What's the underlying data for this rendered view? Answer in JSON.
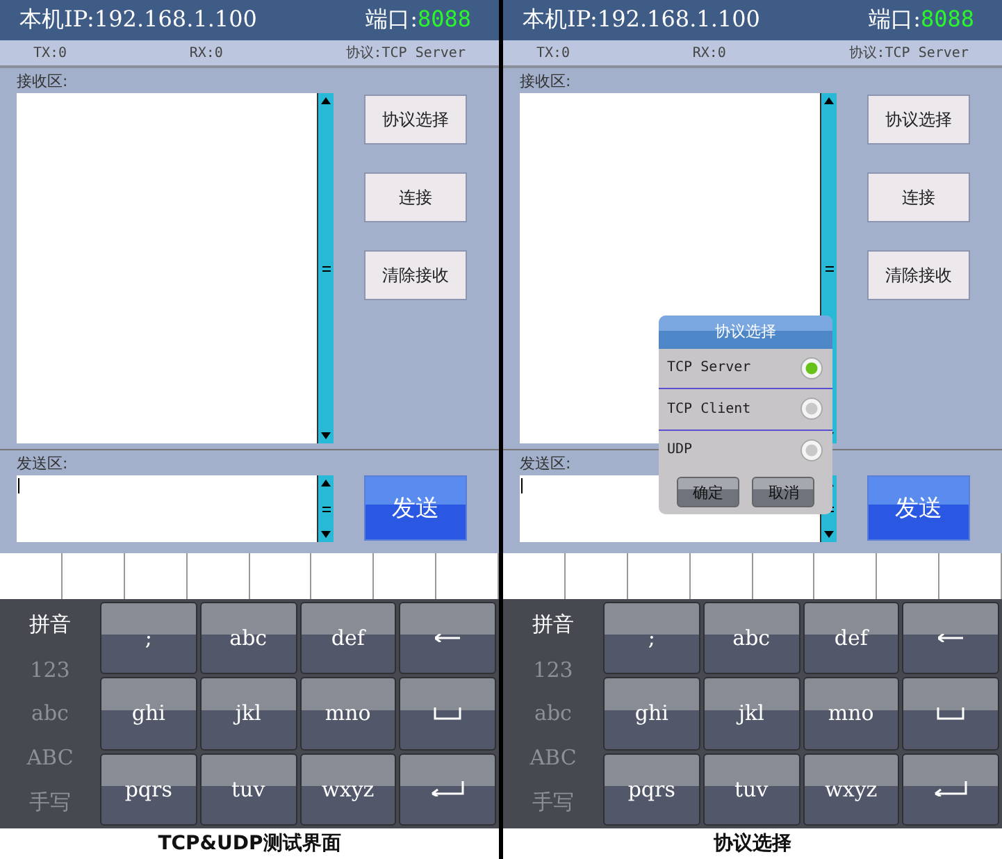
{
  "panels": [
    {
      "caption": "TCP&UDP测试界面",
      "header": {
        "ip_label": "本机IP:192.168.1.100",
        "port_label": "端口:",
        "port": "8088"
      },
      "status": {
        "tx": "TX:0",
        "rx": "RX:0",
        "protocol": "协议:TCP Server"
      },
      "receive_label": "接收区:",
      "buttons": [
        "协议选择",
        "连接",
        "清除接收"
      ],
      "send_label": "发送区:",
      "send_button": "发送",
      "keyboard": {
        "modes": [
          {
            "label": "拼音",
            "selected": true
          },
          {
            "label": "123",
            "selected": false
          },
          {
            "label": "abc",
            "selected": false
          },
          {
            "label": "ABC",
            "selected": false
          },
          {
            "label": "手写",
            "selected": false
          }
        ],
        "keys": [
          {
            "kind": "text",
            "label": ";"
          },
          {
            "kind": "text",
            "label": "abc"
          },
          {
            "kind": "text",
            "label": "def"
          },
          {
            "kind": "backspace"
          },
          {
            "kind": "text",
            "label": "ghi"
          },
          {
            "kind": "text",
            "label": "jkl"
          },
          {
            "kind": "text",
            "label": "mno"
          },
          {
            "kind": "space"
          },
          {
            "kind": "text",
            "label": "pqrs"
          },
          {
            "kind": "text",
            "label": "tuv"
          },
          {
            "kind": "text",
            "label": "wxyz"
          },
          {
            "kind": "enter"
          }
        ]
      }
    },
    {
      "caption": "协议选择",
      "header": {
        "ip_label": "本机IP:192.168.1.100",
        "port_label": "端口:",
        "port": "8088"
      },
      "status": {
        "tx": "TX:0",
        "rx": "RX:0",
        "protocol": "协议:TCP Server"
      },
      "receive_label": "接收区:",
      "buttons": [
        "协议选择",
        "连接",
        "清除接收"
      ],
      "send_label": "发送区:",
      "send_button": "发送",
      "dialog": {
        "title": "协议选择",
        "options": [
          {
            "label": "TCP Server",
            "selected": true
          },
          {
            "label": "TCP Client",
            "selected": false
          },
          {
            "label": "UDP",
            "selected": false
          }
        ],
        "buttons": [
          "确定",
          "取消"
        ]
      },
      "keyboard": {
        "modes": [
          {
            "label": "拼音",
            "selected": true
          },
          {
            "label": "123",
            "selected": false
          },
          {
            "label": "abc",
            "selected": false
          },
          {
            "label": "ABC",
            "selected": false
          },
          {
            "label": "手写",
            "selected": false
          }
        ],
        "keys": [
          {
            "kind": "text",
            "label": ";"
          },
          {
            "kind": "text",
            "label": "abc"
          },
          {
            "kind": "text",
            "label": "def"
          },
          {
            "kind": "backspace"
          },
          {
            "kind": "text",
            "label": "ghi"
          },
          {
            "kind": "text",
            "label": "jkl"
          },
          {
            "kind": "text",
            "label": "mno"
          },
          {
            "kind": "space"
          },
          {
            "kind": "text",
            "label": "pqrs"
          },
          {
            "kind": "text",
            "label": "tuv"
          },
          {
            "kind": "text",
            "label": "wxyz"
          },
          {
            "kind": "enter"
          }
        ]
      }
    }
  ]
}
